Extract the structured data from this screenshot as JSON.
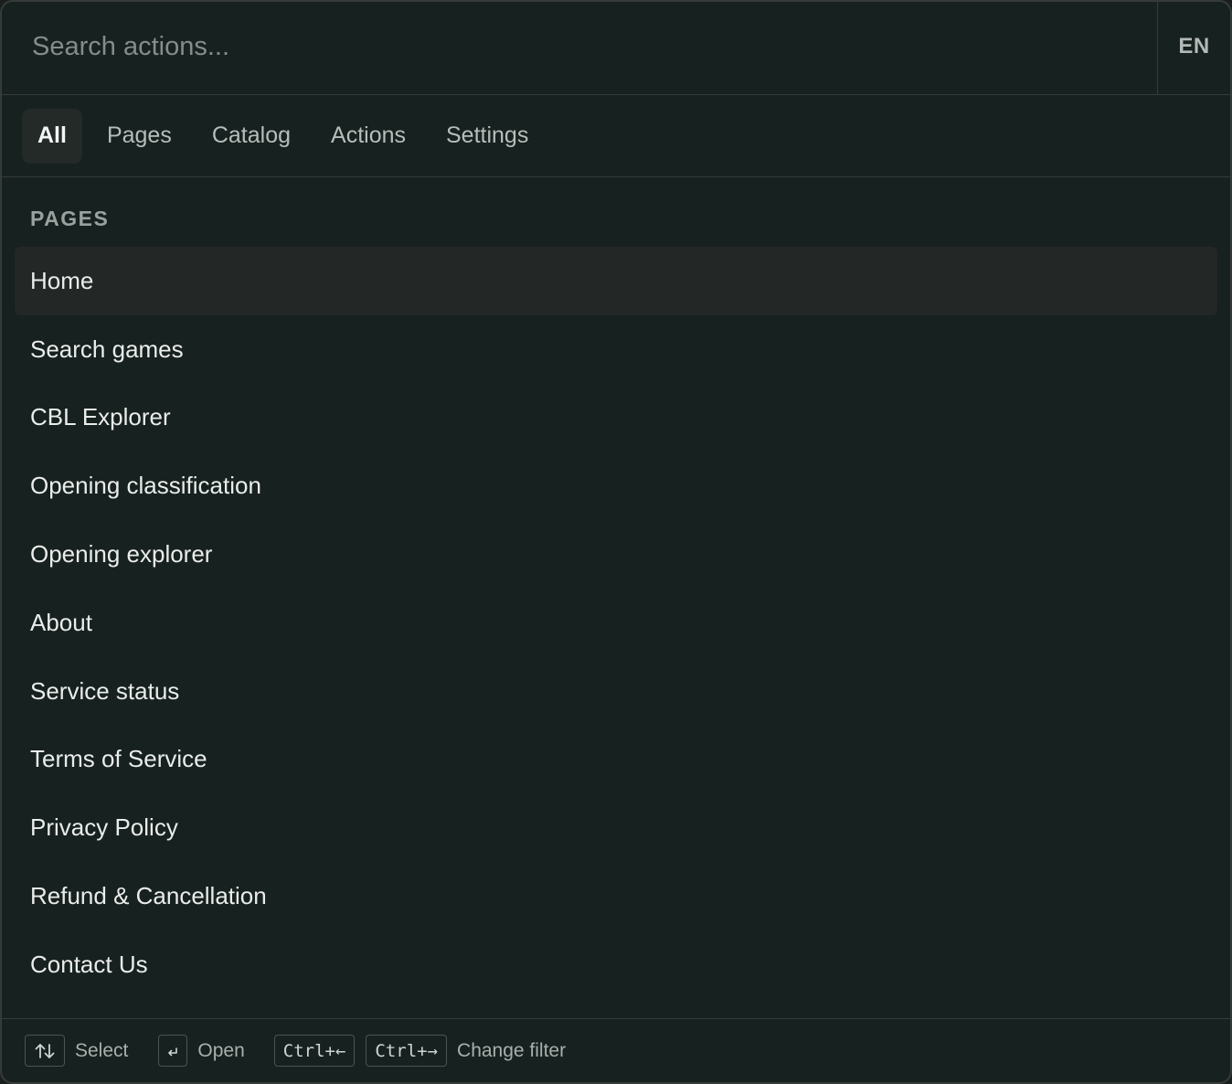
{
  "search": {
    "placeholder": "Search actions..."
  },
  "language": {
    "label": "EN"
  },
  "tabs": [
    {
      "label": "All",
      "active": true
    },
    {
      "label": "Pages",
      "active": false
    },
    {
      "label": "Catalog",
      "active": false
    },
    {
      "label": "Actions",
      "active": false
    },
    {
      "label": "Settings",
      "active": false
    }
  ],
  "section": {
    "heading": "PAGES"
  },
  "items": [
    {
      "label": "Home",
      "selected": true
    },
    {
      "label": "Search games"
    },
    {
      "label": "CBL Explorer"
    },
    {
      "label": "Opening classification"
    },
    {
      "label": "Opening explorer"
    },
    {
      "label": "About"
    },
    {
      "label": "Service status"
    },
    {
      "label": "Terms of Service"
    },
    {
      "label": "Privacy Policy"
    },
    {
      "label": "Refund & Cancellation"
    },
    {
      "label": "Contact Us"
    }
  ],
  "footer": {
    "select_icon": "arrows-up-down-icon",
    "select_label": "Select",
    "open_icon": "enter-return-icon",
    "open_label": "Open",
    "prev_filter_key": "Ctrl+←",
    "next_filter_key": "Ctrl+→",
    "change_filter_label": "Change filter"
  },
  "colors": {
    "background": "#17211f",
    "border": "#343b39",
    "selected_item": "#232726",
    "active_tab": "#232a28"
  }
}
